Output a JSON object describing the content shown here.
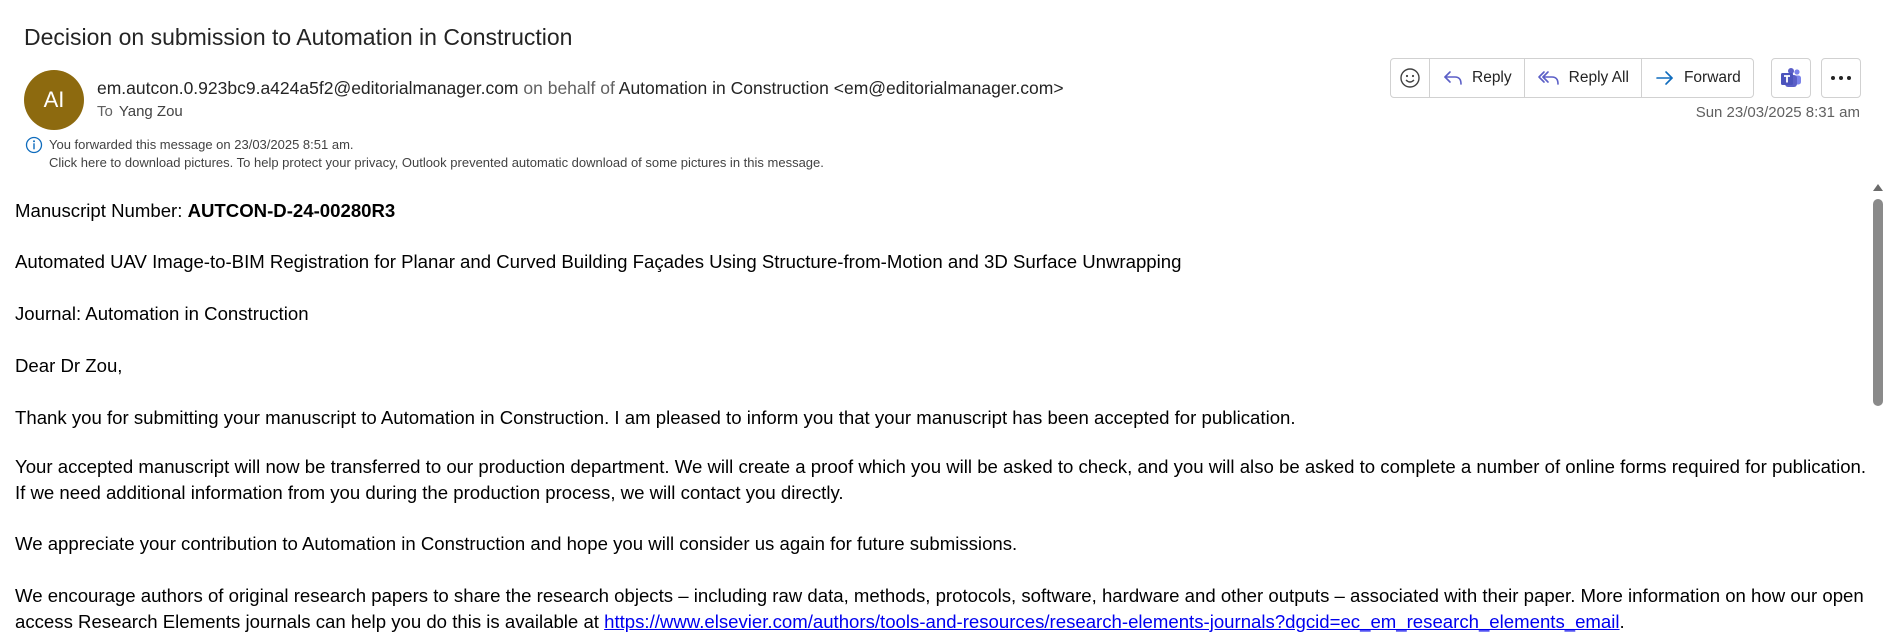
{
  "email": {
    "subject": "Decision on submission to Automation in Construction",
    "avatar_initials": "AI",
    "avatar_color": "#8d6a0f",
    "sender_address": "em.autcon.0.923bc9.a424a5f2@editorialmanager.com",
    "on_behalf_of": "on behalf of",
    "behalf_name": "Automation in Construction <em@editorialmanager.com>",
    "to_label": "To",
    "to_name": "Yang Zou",
    "date": "Sun 23/03/2025 8:31 am",
    "info_forwarded": "You forwarded this message on 23/03/2025 8:51 am.",
    "info_pictures": "Click here to download pictures. To help protect your privacy, Outlook prevented automatic download of some pictures in this message."
  },
  "toolbar": {
    "emoji_icon": "emoji-icon",
    "reply": "Reply",
    "reply_all": "Reply All",
    "forward": "Forward",
    "teams_icon": "teams-icon",
    "more_icon": "more-icon",
    "accent_color": "#5b5fc7"
  },
  "body": {
    "manuscript_label": "Manuscript Number: ",
    "manuscript_number": "AUTCON-D-24-00280R3",
    "title": "Automated UAV Image-to-BIM Registration for Planar and Curved Building Façades Using Structure-from-Motion and 3D Surface Unwrapping",
    "journal": "Journal: Automation in Construction",
    "greeting": "Dear Dr Zou,",
    "thanks": "Thank you for submitting your manuscript to Automation in Construction. I am pleased to inform you that your manuscript has been accepted for publication.",
    "accepted": "Your accepted manuscript will now be transferred to our production department. We will create a proof which you will be asked to check, and you will also be asked to complete a number of online forms required for publication. If we need additional information from you during the production process, we will contact you directly.",
    "appreciate": "We appreciate your contribution to Automation in Construction and hope you will consider us again for future submissions.",
    "encourage": "We encourage authors of original research papers to share the research objects – including raw data, methods, protocols, software, hardware and other outputs – associated with their paper. More information on how our open access Research Elements journals can help you do this is available at ",
    "link": "https://www.elsevier.com/authors/tools-and-resources/research-elements-journals?dgcid=ec_em_research_elements_email",
    "link_suffix": "."
  }
}
